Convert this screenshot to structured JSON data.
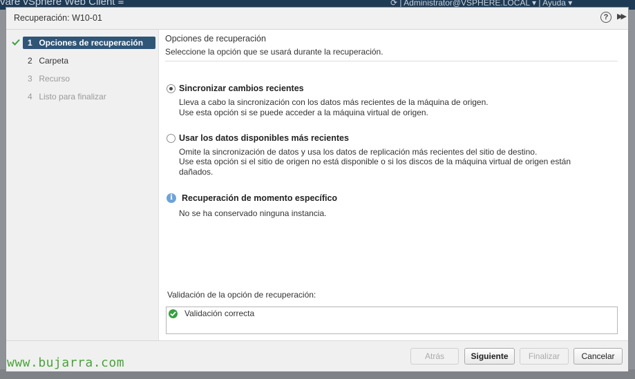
{
  "background": {
    "app_title_fragment": "vare  vSphere Web Client   ≡",
    "user_fragment": "⟳ | Administrator@VSPHERE.LOCAL ▾ | Ayuda ▾"
  },
  "dialog": {
    "title": "Recuperación: W10-01",
    "help_icon": "?",
    "expand_icon": "▶▶"
  },
  "steps": [
    {
      "num": "1",
      "label": "Opciones de recuperación",
      "state": "active"
    },
    {
      "num": "2",
      "label": "Carpeta",
      "state": "normal"
    },
    {
      "num": "3",
      "label": "Recurso",
      "state": "disabled"
    },
    {
      "num": "4",
      "label": "Listo para finalizar",
      "state": "disabled"
    }
  ],
  "page": {
    "title": "Opciones de recuperación",
    "subtitle": "Seleccione la opción que se usará durante la recuperación."
  },
  "options": {
    "sync": {
      "label": "Sincronizar cambios recientes",
      "desc1": "Lleva a cabo la sincronización con los datos más recientes de la máquina de origen.",
      "desc2": "Use esta opción si se puede acceder a la máquina virtual de origen.",
      "checked": true
    },
    "latest": {
      "label": "Usar los datos disponibles más recientes",
      "desc1": "Omite la sincronización de datos y usa los datos de replicación más recientes del sitio de destino.",
      "desc2": "Use esta opción si el sitio de origen no está disponible o si los discos de la máquina virtual de origen están",
      "desc3": "dañados.",
      "checked": false
    },
    "point_in_time": {
      "label": "Recuperación de momento específico",
      "desc": "No se ha conservado ninguna instancia."
    }
  },
  "validation": {
    "label": "Validación de la opción de recuperación:",
    "status": "Validación correcta"
  },
  "buttons": {
    "back": "Atrás",
    "next": "Siguiente",
    "finish": "Finalizar",
    "cancel": "Cancelar"
  },
  "watermark": "www.bujarra.com",
  "colors": {
    "active_step": "#2f5577",
    "ok_green": "#3aa041",
    "info_blue": "#6fa3d8",
    "watermark_green": "#4ba33a"
  },
  "icons": [
    "check-icon",
    "help-icon",
    "expand-icon",
    "info-icon",
    "success-icon"
  ]
}
